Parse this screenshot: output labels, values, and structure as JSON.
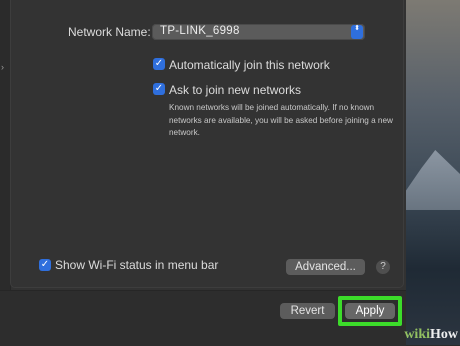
{
  "network": {
    "name_label": "Network Name:",
    "name_value": "TP-LINK_6998",
    "stepper_glyph": "⬍"
  },
  "options": {
    "auto_join": {
      "label": "Automatically join this network",
      "checked": true
    },
    "ask_join": {
      "label": "Ask to join new networks",
      "checked": true
    },
    "ask_join_note": "Known networks will be joined automatically. If no known networks are available, you will be asked before joining a new network.",
    "show_status": {
      "label": "Show Wi-Fi status in menu bar",
      "checked": true
    }
  },
  "buttons": {
    "advanced": "Advanced...",
    "help": "?",
    "revert": "Revert",
    "apply": "Apply"
  },
  "sidebar": {
    "edge_glyph": "›"
  },
  "check_glyph": "✓",
  "watermark": {
    "prefix": "wiki",
    "suffix": "How"
  },
  "colors": {
    "accent": "#2f6fdd",
    "highlight": "#3cdc2a",
    "window": "#323232"
  }
}
